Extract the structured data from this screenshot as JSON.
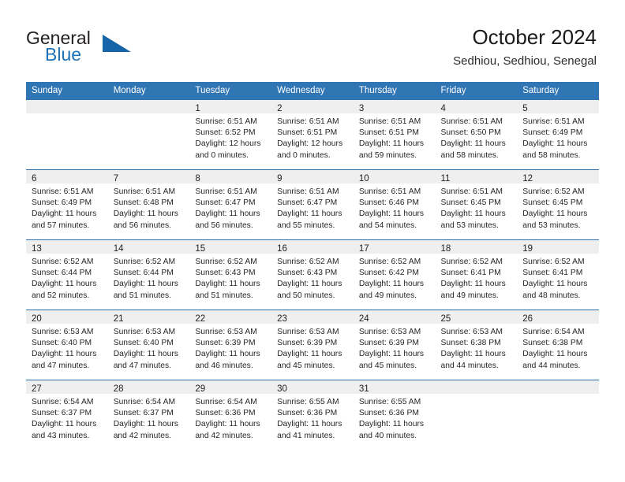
{
  "brand": {
    "line1": "General",
    "line2": "Blue",
    "accent_color": "#1565a8"
  },
  "header": {
    "title": "October 2024",
    "location": "Sedhiou, Sedhiou, Senegal"
  },
  "calendar": {
    "header_bg": "#3075b4",
    "daynum_bg": "#efefef",
    "weekday_headers": [
      "Sunday",
      "Monday",
      "Tuesday",
      "Wednesday",
      "Thursday",
      "Friday",
      "Saturday"
    ],
    "weeks": [
      [
        {
          "day": "",
          "sunrise": "",
          "sunset": "",
          "daylight": ""
        },
        {
          "day": "",
          "sunrise": "",
          "sunset": "",
          "daylight": ""
        },
        {
          "day": "1",
          "sunrise": "Sunrise: 6:51 AM",
          "sunset": "Sunset: 6:52 PM",
          "daylight": "Daylight: 12 hours and 0 minutes."
        },
        {
          "day": "2",
          "sunrise": "Sunrise: 6:51 AM",
          "sunset": "Sunset: 6:51 PM",
          "daylight": "Daylight: 12 hours and 0 minutes."
        },
        {
          "day": "3",
          "sunrise": "Sunrise: 6:51 AM",
          "sunset": "Sunset: 6:51 PM",
          "daylight": "Daylight: 11 hours and 59 minutes."
        },
        {
          "day": "4",
          "sunrise": "Sunrise: 6:51 AM",
          "sunset": "Sunset: 6:50 PM",
          "daylight": "Daylight: 11 hours and 58 minutes."
        },
        {
          "day": "5",
          "sunrise": "Sunrise: 6:51 AM",
          "sunset": "Sunset: 6:49 PM",
          "daylight": "Daylight: 11 hours and 58 minutes."
        }
      ],
      [
        {
          "day": "6",
          "sunrise": "Sunrise: 6:51 AM",
          "sunset": "Sunset: 6:49 PM",
          "daylight": "Daylight: 11 hours and 57 minutes."
        },
        {
          "day": "7",
          "sunrise": "Sunrise: 6:51 AM",
          "sunset": "Sunset: 6:48 PM",
          "daylight": "Daylight: 11 hours and 56 minutes."
        },
        {
          "day": "8",
          "sunrise": "Sunrise: 6:51 AM",
          "sunset": "Sunset: 6:47 PM",
          "daylight": "Daylight: 11 hours and 56 minutes."
        },
        {
          "day": "9",
          "sunrise": "Sunrise: 6:51 AM",
          "sunset": "Sunset: 6:47 PM",
          "daylight": "Daylight: 11 hours and 55 minutes."
        },
        {
          "day": "10",
          "sunrise": "Sunrise: 6:51 AM",
          "sunset": "Sunset: 6:46 PM",
          "daylight": "Daylight: 11 hours and 54 minutes."
        },
        {
          "day": "11",
          "sunrise": "Sunrise: 6:51 AM",
          "sunset": "Sunset: 6:45 PM",
          "daylight": "Daylight: 11 hours and 53 minutes."
        },
        {
          "day": "12",
          "sunrise": "Sunrise: 6:52 AM",
          "sunset": "Sunset: 6:45 PM",
          "daylight": "Daylight: 11 hours and 53 minutes."
        }
      ],
      [
        {
          "day": "13",
          "sunrise": "Sunrise: 6:52 AM",
          "sunset": "Sunset: 6:44 PM",
          "daylight": "Daylight: 11 hours and 52 minutes."
        },
        {
          "day": "14",
          "sunrise": "Sunrise: 6:52 AM",
          "sunset": "Sunset: 6:44 PM",
          "daylight": "Daylight: 11 hours and 51 minutes."
        },
        {
          "day": "15",
          "sunrise": "Sunrise: 6:52 AM",
          "sunset": "Sunset: 6:43 PM",
          "daylight": "Daylight: 11 hours and 51 minutes."
        },
        {
          "day": "16",
          "sunrise": "Sunrise: 6:52 AM",
          "sunset": "Sunset: 6:43 PM",
          "daylight": "Daylight: 11 hours and 50 minutes."
        },
        {
          "day": "17",
          "sunrise": "Sunrise: 6:52 AM",
          "sunset": "Sunset: 6:42 PM",
          "daylight": "Daylight: 11 hours and 49 minutes."
        },
        {
          "day": "18",
          "sunrise": "Sunrise: 6:52 AM",
          "sunset": "Sunset: 6:41 PM",
          "daylight": "Daylight: 11 hours and 49 minutes."
        },
        {
          "day": "19",
          "sunrise": "Sunrise: 6:52 AM",
          "sunset": "Sunset: 6:41 PM",
          "daylight": "Daylight: 11 hours and 48 minutes."
        }
      ],
      [
        {
          "day": "20",
          "sunrise": "Sunrise: 6:53 AM",
          "sunset": "Sunset: 6:40 PM",
          "daylight": "Daylight: 11 hours and 47 minutes."
        },
        {
          "day": "21",
          "sunrise": "Sunrise: 6:53 AM",
          "sunset": "Sunset: 6:40 PM",
          "daylight": "Daylight: 11 hours and 47 minutes."
        },
        {
          "day": "22",
          "sunrise": "Sunrise: 6:53 AM",
          "sunset": "Sunset: 6:39 PM",
          "daylight": "Daylight: 11 hours and 46 minutes."
        },
        {
          "day": "23",
          "sunrise": "Sunrise: 6:53 AM",
          "sunset": "Sunset: 6:39 PM",
          "daylight": "Daylight: 11 hours and 45 minutes."
        },
        {
          "day": "24",
          "sunrise": "Sunrise: 6:53 AM",
          "sunset": "Sunset: 6:39 PM",
          "daylight": "Daylight: 11 hours and 45 minutes."
        },
        {
          "day": "25",
          "sunrise": "Sunrise: 6:53 AM",
          "sunset": "Sunset: 6:38 PM",
          "daylight": "Daylight: 11 hours and 44 minutes."
        },
        {
          "day": "26",
          "sunrise": "Sunrise: 6:54 AM",
          "sunset": "Sunset: 6:38 PM",
          "daylight": "Daylight: 11 hours and 44 minutes."
        }
      ],
      [
        {
          "day": "27",
          "sunrise": "Sunrise: 6:54 AM",
          "sunset": "Sunset: 6:37 PM",
          "daylight": "Daylight: 11 hours and 43 minutes."
        },
        {
          "day": "28",
          "sunrise": "Sunrise: 6:54 AM",
          "sunset": "Sunset: 6:37 PM",
          "daylight": "Daylight: 11 hours and 42 minutes."
        },
        {
          "day": "29",
          "sunrise": "Sunrise: 6:54 AM",
          "sunset": "Sunset: 6:36 PM",
          "daylight": "Daylight: 11 hours and 42 minutes."
        },
        {
          "day": "30",
          "sunrise": "Sunrise: 6:55 AM",
          "sunset": "Sunset: 6:36 PM",
          "daylight": "Daylight: 11 hours and 41 minutes."
        },
        {
          "day": "31",
          "sunrise": "Sunrise: 6:55 AM",
          "sunset": "Sunset: 6:36 PM",
          "daylight": "Daylight: 11 hours and 40 minutes."
        },
        {
          "day": "",
          "sunrise": "",
          "sunset": "",
          "daylight": ""
        },
        {
          "day": "",
          "sunrise": "",
          "sunset": "",
          "daylight": ""
        }
      ]
    ]
  }
}
